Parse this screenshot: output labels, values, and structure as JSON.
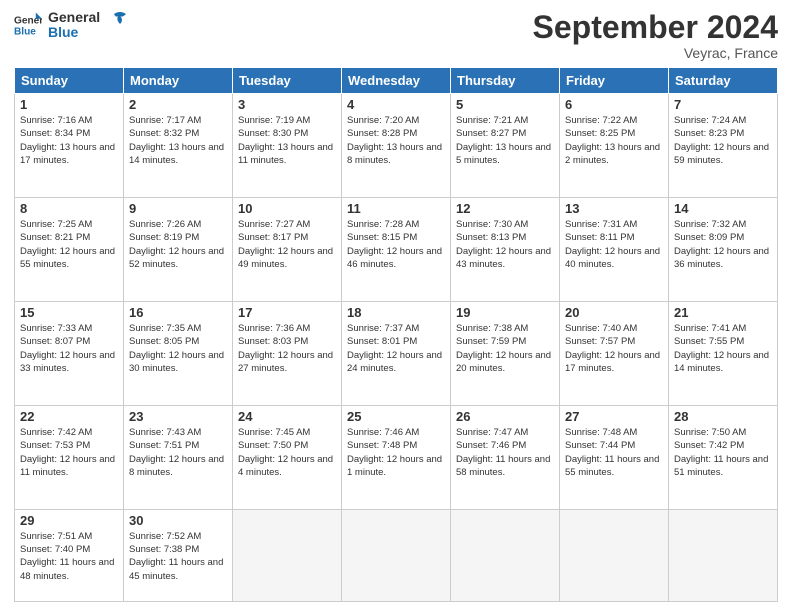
{
  "header": {
    "logo_general": "General",
    "logo_blue": "Blue",
    "month_title": "September 2024",
    "subtitle": "Veyrac, France"
  },
  "weekdays": [
    "Sunday",
    "Monday",
    "Tuesday",
    "Wednesday",
    "Thursday",
    "Friday",
    "Saturday"
  ],
  "weeks": [
    [
      {
        "day": "1",
        "info": "Sunrise: 7:16 AM\nSunset: 8:34 PM\nDaylight: 13 hours and 17 minutes."
      },
      {
        "day": "2",
        "info": "Sunrise: 7:17 AM\nSunset: 8:32 PM\nDaylight: 13 hours and 14 minutes."
      },
      {
        "day": "3",
        "info": "Sunrise: 7:19 AM\nSunset: 8:30 PM\nDaylight: 13 hours and 11 minutes."
      },
      {
        "day": "4",
        "info": "Sunrise: 7:20 AM\nSunset: 8:28 PM\nDaylight: 13 hours and 8 minutes."
      },
      {
        "day": "5",
        "info": "Sunrise: 7:21 AM\nSunset: 8:27 PM\nDaylight: 13 hours and 5 minutes."
      },
      {
        "day": "6",
        "info": "Sunrise: 7:22 AM\nSunset: 8:25 PM\nDaylight: 13 hours and 2 minutes."
      },
      {
        "day": "7",
        "info": "Sunrise: 7:24 AM\nSunset: 8:23 PM\nDaylight: 12 hours and 59 minutes."
      }
    ],
    [
      {
        "day": "8",
        "info": "Sunrise: 7:25 AM\nSunset: 8:21 PM\nDaylight: 12 hours and 55 minutes."
      },
      {
        "day": "9",
        "info": "Sunrise: 7:26 AM\nSunset: 8:19 PM\nDaylight: 12 hours and 52 minutes."
      },
      {
        "day": "10",
        "info": "Sunrise: 7:27 AM\nSunset: 8:17 PM\nDaylight: 12 hours and 49 minutes."
      },
      {
        "day": "11",
        "info": "Sunrise: 7:28 AM\nSunset: 8:15 PM\nDaylight: 12 hours and 46 minutes."
      },
      {
        "day": "12",
        "info": "Sunrise: 7:30 AM\nSunset: 8:13 PM\nDaylight: 12 hours and 43 minutes."
      },
      {
        "day": "13",
        "info": "Sunrise: 7:31 AM\nSunset: 8:11 PM\nDaylight: 12 hours and 40 minutes."
      },
      {
        "day": "14",
        "info": "Sunrise: 7:32 AM\nSunset: 8:09 PM\nDaylight: 12 hours and 36 minutes."
      }
    ],
    [
      {
        "day": "15",
        "info": "Sunrise: 7:33 AM\nSunset: 8:07 PM\nDaylight: 12 hours and 33 minutes."
      },
      {
        "day": "16",
        "info": "Sunrise: 7:35 AM\nSunset: 8:05 PM\nDaylight: 12 hours and 30 minutes."
      },
      {
        "day": "17",
        "info": "Sunrise: 7:36 AM\nSunset: 8:03 PM\nDaylight: 12 hours and 27 minutes."
      },
      {
        "day": "18",
        "info": "Sunrise: 7:37 AM\nSunset: 8:01 PM\nDaylight: 12 hours and 24 minutes."
      },
      {
        "day": "19",
        "info": "Sunrise: 7:38 AM\nSunset: 7:59 PM\nDaylight: 12 hours and 20 minutes."
      },
      {
        "day": "20",
        "info": "Sunrise: 7:40 AM\nSunset: 7:57 PM\nDaylight: 12 hours and 17 minutes."
      },
      {
        "day": "21",
        "info": "Sunrise: 7:41 AM\nSunset: 7:55 PM\nDaylight: 12 hours and 14 minutes."
      }
    ],
    [
      {
        "day": "22",
        "info": "Sunrise: 7:42 AM\nSunset: 7:53 PM\nDaylight: 12 hours and 11 minutes."
      },
      {
        "day": "23",
        "info": "Sunrise: 7:43 AM\nSunset: 7:51 PM\nDaylight: 12 hours and 8 minutes."
      },
      {
        "day": "24",
        "info": "Sunrise: 7:45 AM\nSunset: 7:50 PM\nDaylight: 12 hours and 4 minutes."
      },
      {
        "day": "25",
        "info": "Sunrise: 7:46 AM\nSunset: 7:48 PM\nDaylight: 12 hours and 1 minute."
      },
      {
        "day": "26",
        "info": "Sunrise: 7:47 AM\nSunset: 7:46 PM\nDaylight: 11 hours and 58 minutes."
      },
      {
        "day": "27",
        "info": "Sunrise: 7:48 AM\nSunset: 7:44 PM\nDaylight: 11 hours and 55 minutes."
      },
      {
        "day": "28",
        "info": "Sunrise: 7:50 AM\nSunset: 7:42 PM\nDaylight: 11 hours and 51 minutes."
      }
    ],
    [
      {
        "day": "29",
        "info": "Sunrise: 7:51 AM\nSunset: 7:40 PM\nDaylight: 11 hours and 48 minutes."
      },
      {
        "day": "30",
        "info": "Sunrise: 7:52 AM\nSunset: 7:38 PM\nDaylight: 11 hours and 45 minutes."
      },
      {
        "day": "",
        "info": ""
      },
      {
        "day": "",
        "info": ""
      },
      {
        "day": "",
        "info": ""
      },
      {
        "day": "",
        "info": ""
      },
      {
        "day": "",
        "info": ""
      }
    ]
  ]
}
